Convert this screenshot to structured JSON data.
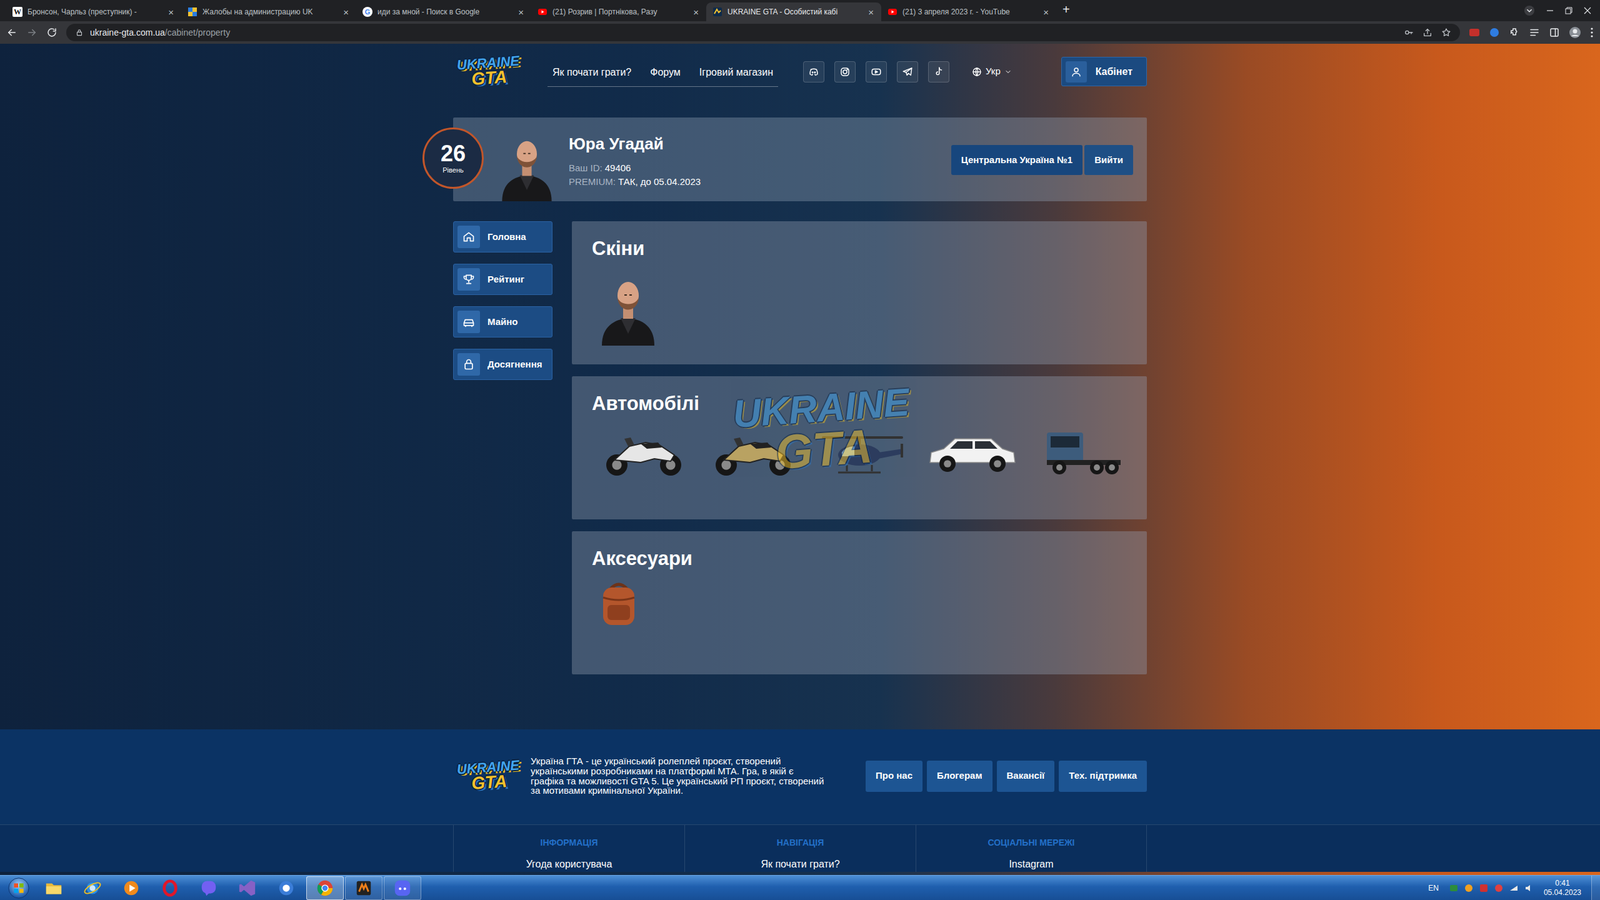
{
  "browser": {
    "tabs": [
      {
        "label": "Бронсон, Чарльз (преступник) -",
        "kind": "wiki",
        "icon_text": "W",
        "close": "×",
        "selected": false
      },
      {
        "label": "Жалобы на администрацию UK",
        "kind": "forum",
        "close": "×",
        "selected": false
      },
      {
        "label": "иди за мной - Поиск в Google",
        "kind": "google",
        "icon_text": "G",
        "close": "×",
        "selected": false
      },
      {
        "label": "(21) Розрив | Портнікова, Разу",
        "kind": "youtube",
        "close": "×",
        "selected": false
      },
      {
        "label": "UKRAINE GTA - Особистий кабі",
        "kind": "site",
        "close": "×",
        "selected": true
      },
      {
        "label": "(21) 3 апреля 2023 г. - YouTube",
        "kind": "youtube",
        "close": "×",
        "selected": false
      }
    ],
    "new_tab": "+",
    "url": {
      "host": "ukraine-gta.com.ua",
      "path": "/cabinet/property"
    }
  },
  "site": {
    "logo": {
      "line1": "UKRAINE",
      "line2": "GTA"
    },
    "nav": [
      "Як почати грати?",
      "Форум",
      "Ігровий магазин"
    ],
    "socials": [
      {
        "kind": "discord"
      },
      {
        "kind": "instagram"
      },
      {
        "kind": "youtube"
      },
      {
        "kind": "telegram"
      },
      {
        "kind": "tiktok"
      }
    ],
    "language": "Укр",
    "cabinet_button": "Кабінет"
  },
  "profile": {
    "level": "26",
    "level_label": "Рівень",
    "name": "Юра Угадай",
    "id_label": "Ваш ID:",
    "id": "49406",
    "premium_label": "PREMIUM:",
    "premium_value": "ТАК, до 05.04.2023",
    "server_button": "Центральна Україна №1",
    "logout_button": "Вийти"
  },
  "sidebar": {
    "items": [
      {
        "label": "Головна",
        "kind": "home"
      },
      {
        "label": "Рейтинг",
        "kind": "trophy"
      },
      {
        "label": "Майно",
        "kind": "car"
      },
      {
        "label": "Досягнення",
        "kind": "lock"
      }
    ]
  },
  "sections": [
    {
      "title": "Скіни",
      "items": [
        {
          "kind": "skin"
        }
      ]
    },
    {
      "title": "Автомобілі",
      "items": [
        {
          "kind": "motorcycle",
          "color": "#e6e6e6"
        },
        {
          "kind": "motorcycle",
          "color": "#b9a263"
        },
        {
          "kind": "helicopter",
          "color": "#2c3d5e"
        },
        {
          "kind": "suv",
          "color": "#f2f2f2"
        },
        {
          "kind": "truck",
          "color": "#3d5c7c"
        }
      ],
      "watermark": {
        "line1": "UKRAINE",
        "line2": "GTA"
      }
    },
    {
      "title": "Аксесуари",
      "items": [
        {
          "kind": "backpack"
        }
      ]
    }
  ],
  "footer": {
    "logo": {
      "line1": "UKRAINE",
      "line2": "GTA"
    },
    "description": "Україна ГТА - це український ролеплей проєкт, створений українськими розробниками на платформі MTA. Гра, в якій є графіка та можливості GTA 5. Це український РП проєкт, створений за мотивами кримінальної України.",
    "buttons": [
      "Про нас",
      "Блогерам",
      "Вакансії",
      "Тех. підтримка"
    ],
    "columns": [
      {
        "heading": "ІНФОРМАЦІЯ",
        "links": [
          "Угода користувача"
        ]
      },
      {
        "heading": "НАВІГАЦІЯ",
        "links": [
          "Як почати грати?"
        ]
      },
      {
        "heading": "СОЦІАЛЬНІ МЕРЕЖІ",
        "links": [
          "Instagram"
        ]
      }
    ]
  },
  "taskbar": {
    "apps": [
      {
        "kind": "folder",
        "running": false,
        "selected": false
      },
      {
        "kind": "ie",
        "running": false,
        "selected": false
      },
      {
        "kind": "media",
        "running": false,
        "selected": false
      },
      {
        "kind": "opera",
        "running": false,
        "selected": false
      },
      {
        "kind": "viber",
        "running": false,
        "selected": false
      },
      {
        "kind": "vs",
        "running": false,
        "selected": false
      },
      {
        "kind": "app",
        "running": false,
        "selected": false
      },
      {
        "kind": "chrome",
        "running": true,
        "selected": true
      },
      {
        "kind": "mta",
        "running": true,
        "selected": false
      },
      {
        "kind": "discord",
        "running": true,
        "selected": false
      }
    ],
    "language": "EN",
    "time": "0:41",
    "date": "05.04.2023"
  }
}
